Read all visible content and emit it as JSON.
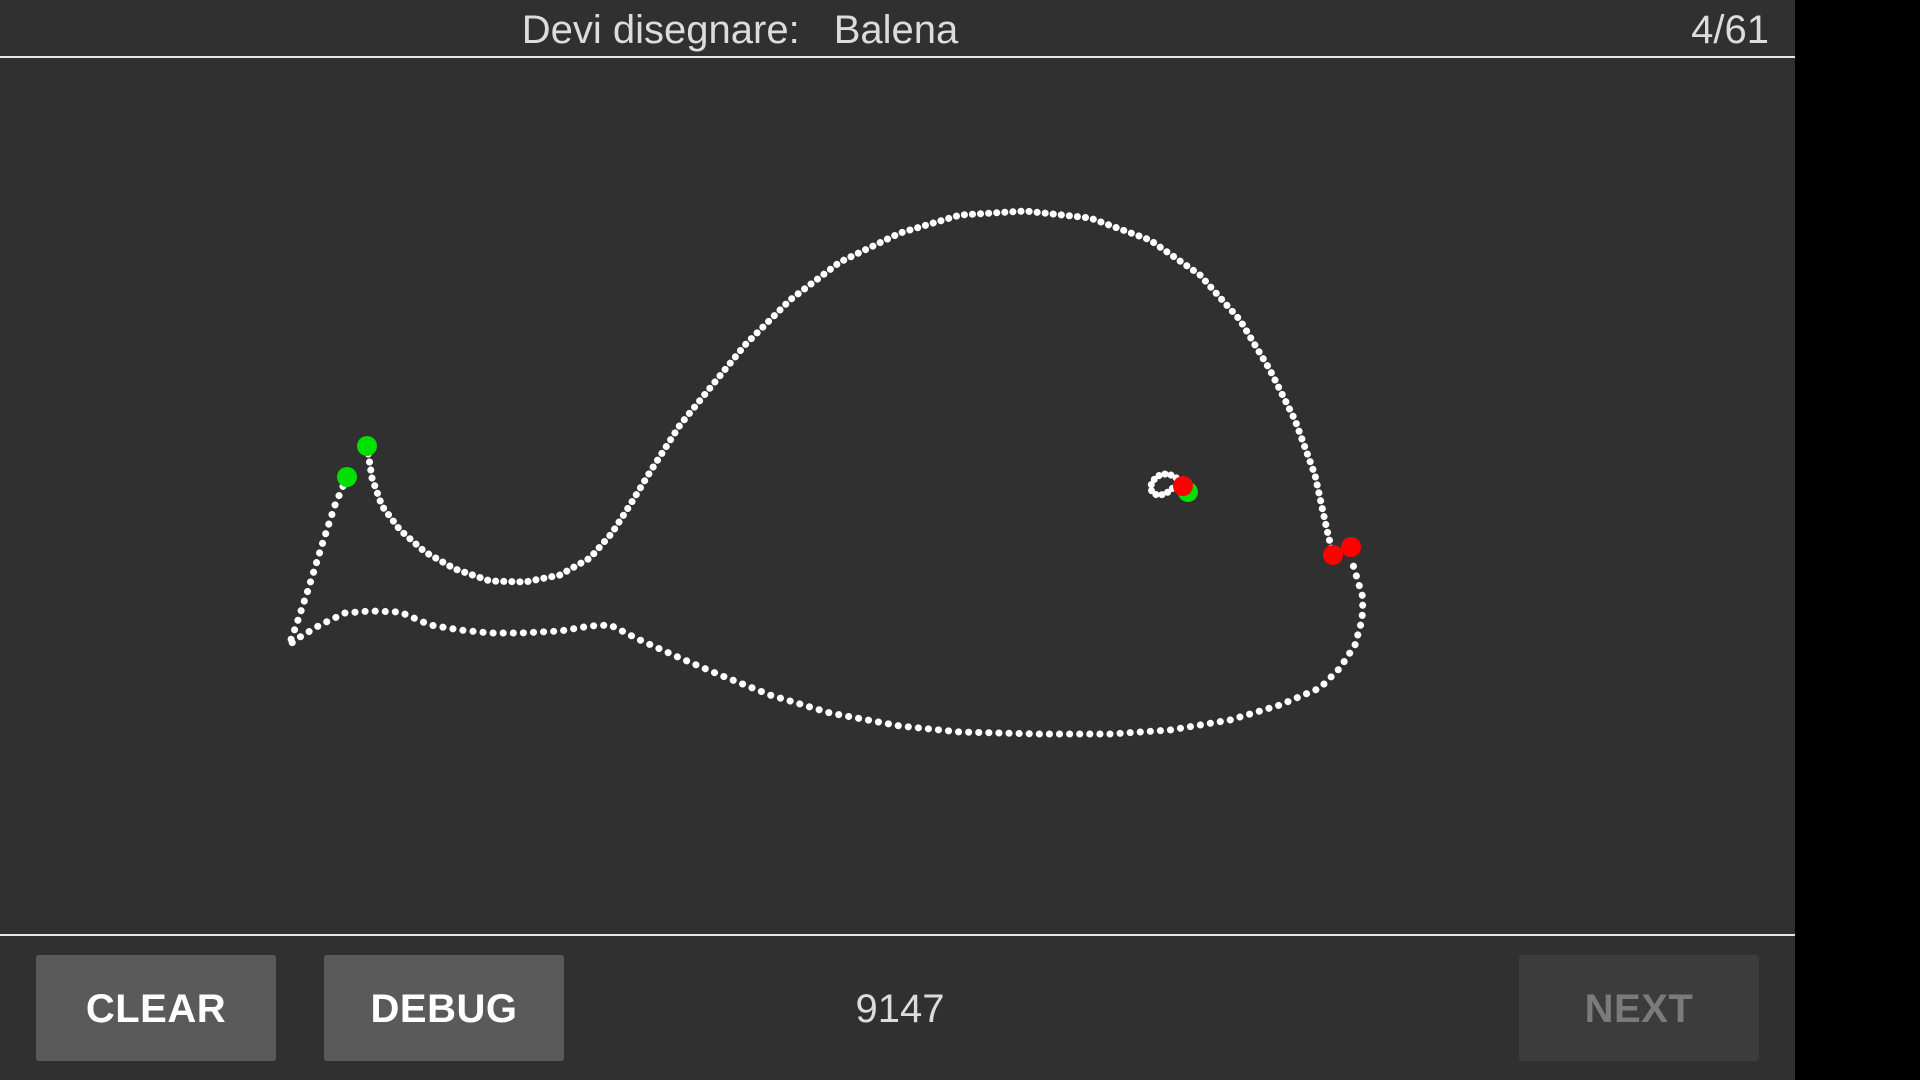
{
  "header": {
    "prompt_label": "Devi disegnare:",
    "target_word": "Balena",
    "progress": "4/61"
  },
  "footer": {
    "clear_label": "CLEAR",
    "debug_label": "DEBUG",
    "score": "9147",
    "next_label": "NEXT",
    "next_enabled": false
  },
  "drawing": {
    "stroke_color": "#ffffff",
    "start_marker_color": "#00e000",
    "end_marker_color": "#ff0000",
    "stroke_count": 3
  }
}
